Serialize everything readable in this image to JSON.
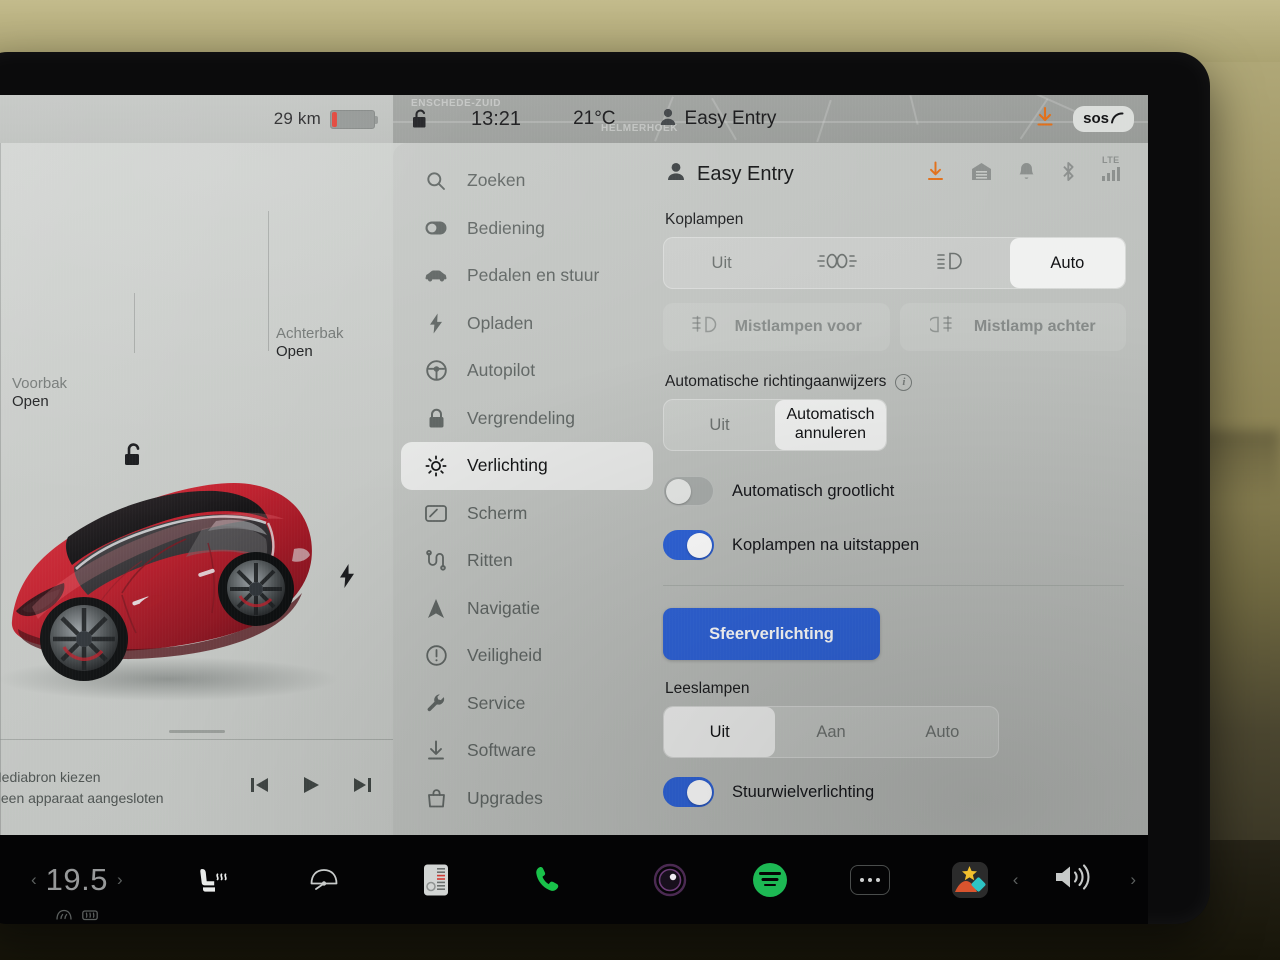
{
  "status_bar": {
    "range": "29 km",
    "battery_icon": "battery-low-icon",
    "lock_icon": "unlock-icon",
    "time": "13:21",
    "temperature": "21°C",
    "profile_icon": "person-icon",
    "profile_name": "Easy Entry",
    "download_icon": "download-icon",
    "sos_label": "sos",
    "map_places": [
      "ENSCHEDE-ZUID",
      "HELMERHOEK"
    ]
  },
  "car_panel": {
    "frunk": {
      "title": "Voorbak",
      "state": "Open"
    },
    "trunk": {
      "title": "Achterbak",
      "state": "Open"
    },
    "unlock_icon": "unlock-open-icon",
    "charge_port_icon": "charge-bolt-icon",
    "media": {
      "line1": "Mediabron kiezen",
      "line2": "Geen apparaat aangesloten",
      "prev_icon": "previous-track-icon",
      "play_icon": "play-icon",
      "next_icon": "next-track-icon"
    }
  },
  "sidebar": {
    "items": [
      {
        "label": "Zoeken",
        "icon": "search-icon",
        "active": false
      },
      {
        "label": "Bediening",
        "icon": "toggle-icon",
        "active": false
      },
      {
        "label": "Pedalen en stuur",
        "icon": "car-icon",
        "active": false
      },
      {
        "label": "Opladen",
        "icon": "bolt-icon",
        "active": false
      },
      {
        "label": "Autopilot",
        "icon": "steering-wheel-icon",
        "active": false
      },
      {
        "label": "Vergrendeling",
        "icon": "lock-icon",
        "active": false
      },
      {
        "label": "Verlichting",
        "icon": "light-icon",
        "active": true
      },
      {
        "label": "Scherm",
        "icon": "display-icon",
        "active": false
      },
      {
        "label": "Ritten",
        "icon": "trips-icon",
        "active": false
      },
      {
        "label": "Navigatie",
        "icon": "navigation-icon",
        "active": false
      },
      {
        "label": "Veiligheid",
        "icon": "safety-icon",
        "active": false
      },
      {
        "label": "Service",
        "icon": "wrench-icon",
        "active": false
      },
      {
        "label": "Software",
        "icon": "download-icon",
        "active": false
      },
      {
        "label": "Upgrades",
        "icon": "bag-icon",
        "active": false
      }
    ]
  },
  "content": {
    "header": {
      "profile_icon": "person-icon",
      "title": "Easy Entry",
      "icons": [
        "download-icon",
        "garage-icon",
        "bell-icon",
        "bluetooth-icon",
        "lte-signal-icon"
      ],
      "lte_label": "LTE"
    },
    "headlights": {
      "label": "Koplampen",
      "options": [
        {
          "label": "Uit",
          "icon": null,
          "selected": false
        },
        {
          "label": "",
          "icon": "parking-lights-icon",
          "selected": false
        },
        {
          "label": "",
          "icon": "low-beam-icon",
          "selected": false
        },
        {
          "label": "Auto",
          "icon": null,
          "selected": true
        }
      ]
    },
    "fog_lamps": [
      {
        "label": "Mistlampen voor",
        "icon": "front-fog-lamp-icon",
        "enabled": false
      },
      {
        "label": "Mistlamp achter",
        "icon": "rear-fog-lamp-icon",
        "enabled": false
      }
    ],
    "auto_turn_signals": {
      "label": "Automatische richtingaanwijzers",
      "info_icon": "info-icon",
      "options": [
        {
          "label": "Uit",
          "selected": false
        },
        {
          "label": "Automatisch annuleren",
          "selected": true
        }
      ]
    },
    "toggles": [
      {
        "label": "Automatisch grootlicht",
        "on": false
      },
      {
        "label": "Koplampen na uitstappen",
        "on": true
      }
    ],
    "ambient_button": {
      "label": "Sfeerverlichting"
    },
    "reading_lights": {
      "label": "Leeslampen",
      "options": [
        {
          "label": "Uit",
          "selected": true
        },
        {
          "label": "Aan",
          "selected": false
        },
        {
          "label": "Auto",
          "selected": false
        }
      ]
    },
    "steering_wheel_light": {
      "label": "Stuurwielverlichting",
      "on": true
    }
  },
  "dock": {
    "temperature": "19.5",
    "prev_icon": "chevron-left-icon",
    "next_icon": "chevron-right-icon",
    "defrost_front_icon": "defrost-front-icon",
    "defrost_rear_icon": "defrost-rear-icon",
    "items": [
      {
        "name": "seat-heater-icon"
      },
      {
        "name": "wiper-icon"
      },
      {
        "name": "climate-fan-icon"
      },
      {
        "name": "phone-icon"
      },
      {
        "name": "dashcam-icon"
      },
      {
        "name": "spotify-icon"
      },
      {
        "name": "more-apps-icon"
      },
      {
        "name": "toybox-icon"
      }
    ],
    "volume_down_icon": "chevron-left-icon",
    "volume_icon": "volume-icon",
    "volume_up_icon": "chevron-right-icon"
  },
  "colors": {
    "accent_blue": "#2f63d8",
    "accent_orange": "#e2701a",
    "spotify_green": "#1db954",
    "phone_green": "#19c24a",
    "battery_red": "#e03a2f"
  }
}
